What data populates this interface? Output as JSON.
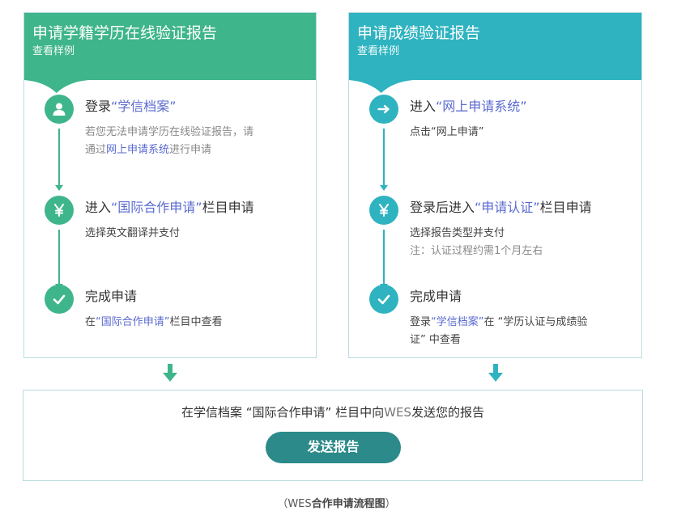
{
  "left_panel": {
    "title": "申请学籍学历在线验证报告",
    "sample_link": "查看样例",
    "steps": [
      {
        "icon": "user-icon",
        "title_prefix": "登录",
        "title_link": "“学信档案”",
        "title_suffix": "",
        "desc_line1": "若您无法申请学历在线验证报告，请",
        "desc_line2_prefix": "通过",
        "desc_line2_link": "网上申请系统",
        "desc_line2_suffix": "进行申请"
      },
      {
        "icon": "yen-icon",
        "title_prefix": "进入",
        "title_link": "“国际合作申请”",
        "title_suffix": "栏目申请",
        "desc": "选择英文翻译并支付"
      },
      {
        "icon": "check-icon",
        "title": "完成申请",
        "desc_prefix": "在",
        "desc_link": "“国际合作申请”",
        "desc_suffix": "栏目中查看"
      }
    ]
  },
  "right_panel": {
    "title": "申请成绩验证报告",
    "sample_link": "查看样例",
    "steps": [
      {
        "icon": "arrow-right-icon",
        "title_prefix": "进入",
        "title_link": "“网上申请系统”",
        "title_suffix": "",
        "desc": "点击“网上申请”"
      },
      {
        "icon": "yen-icon",
        "title_prefix": "登录后进入",
        "title_link": "“申请认证”",
        "title_suffix": "栏目申请",
        "desc_line1": "选择报告类型并支付",
        "desc_line2": "注：认证过程约需1个月左右"
      },
      {
        "icon": "check-icon",
        "title": "完成申请",
        "desc_line1_prefix": "登录",
        "desc_line1_link": "“学信档案”",
        "desc_line1_suffix": "在 “学历认证与成绩验",
        "desc_line2": "证” 中查看"
      }
    ]
  },
  "bottom": {
    "text_prefix": "在学信档案 “国际合作申请” 栏目中向",
    "text_wes": "WES",
    "text_suffix": "发送您的报告",
    "button_label": "发送报告"
  },
  "caption": {
    "open": "（WES",
    "bold": "合作申请流程图",
    "close": "）"
  },
  "colors": {
    "green": "#3fb58b",
    "teal": "#2fb3c0",
    "button": "#2d8a8a",
    "link": "#5a6ad0"
  }
}
